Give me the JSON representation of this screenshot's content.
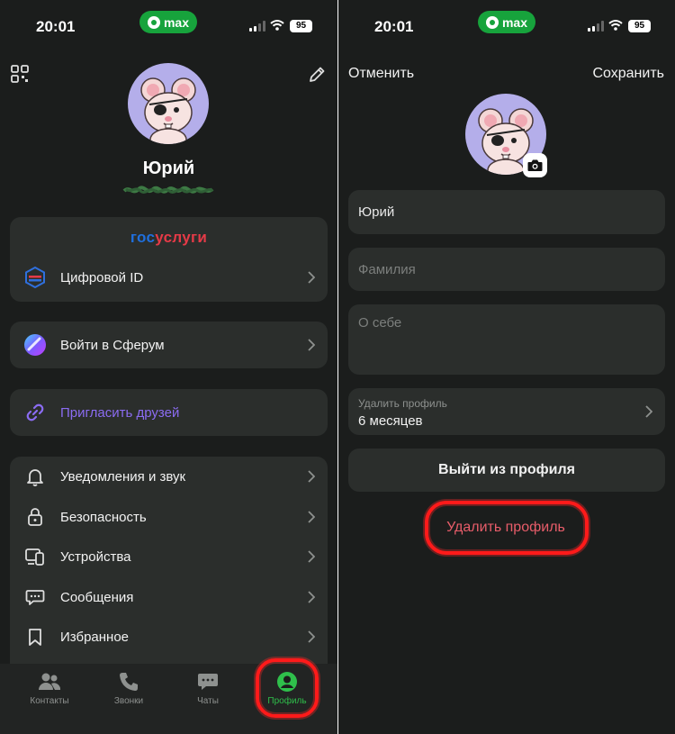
{
  "status_bar": {
    "time": "20:01",
    "app_pill": "max",
    "battery": "95"
  },
  "left": {
    "profile_name": "Юрий",
    "gosuslugi": {
      "part_a": "гос",
      "part_b": "услуги"
    },
    "items": {
      "digital_id": "Цифровой ID",
      "sferum": "Войти в Сферум",
      "invite": "Пригласить друзей",
      "notifications": "Уведомления и звук",
      "security": "Безопасность",
      "devices": "Устройства",
      "messages": "Сообщения",
      "favorites": "Избранное"
    },
    "tabs": {
      "contacts": "Контакты",
      "calls": "Звонки",
      "chats": "Чаты",
      "profile": "Профиль"
    }
  },
  "right": {
    "cancel": "Отменить",
    "save": "Сохранить",
    "first_name_value": "Юрий",
    "last_name_placeholder": "Фамилия",
    "about_placeholder": "О себе",
    "delete_period_label": "Удалить профиль",
    "delete_period_value": "6 месяцев",
    "logout": "Выйти из профиля",
    "delete_profile": "Удалить профиль"
  },
  "colors": {
    "background": "#1b1d1c",
    "card": "#2b2e2c",
    "accent_green": "#2fbf4b",
    "invite_purple": "#8b6cf2",
    "danger": "#e85d6a",
    "annotation_red": "#ff1a1a"
  }
}
